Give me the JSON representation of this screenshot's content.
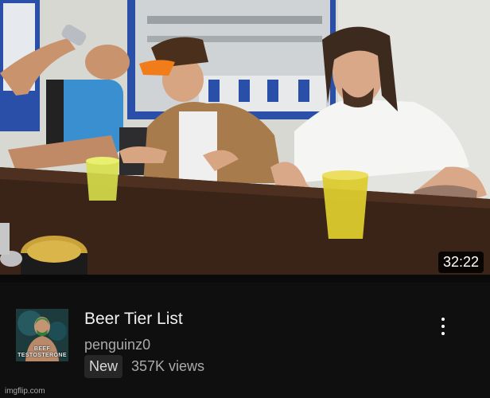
{
  "video": {
    "duration": "32:22",
    "title": "Beer Tier List",
    "channel": "penguinz0",
    "badge": "New",
    "views": "357K views"
  },
  "avatar": {
    "text_line1": "BEEF",
    "text_line2": "TESTOSTERONE"
  },
  "watermark": "imgflip.com",
  "colors": {
    "background": "#0f0f0f",
    "title": "#f1f1f1",
    "secondary_text": "#aaaaaa",
    "badge_bg": "#272727"
  },
  "icons": {
    "menu": "more-vert-icon"
  }
}
